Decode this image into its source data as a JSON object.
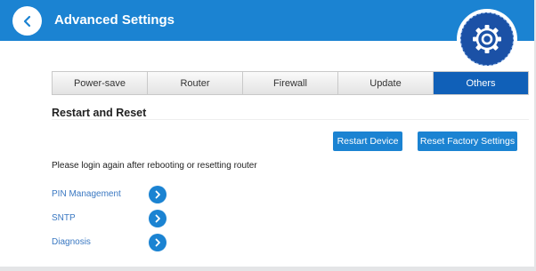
{
  "header": {
    "title": "Advanced Settings",
    "back_icon": "chevron-left-icon",
    "settings_icon": "gear-icon",
    "color": "#1b83d2"
  },
  "tabs": [
    {
      "label": "Power-save",
      "active": false
    },
    {
      "label": "Router",
      "active": false
    },
    {
      "label": "Firewall",
      "active": false
    },
    {
      "label": "Update",
      "active": false
    },
    {
      "label": "Others",
      "active": true
    }
  ],
  "section": {
    "title": "Restart and Reset",
    "restart_button": "Restart Device",
    "reset_button": "Reset Factory Settings",
    "notice": "Please login again after rebooting or resetting router"
  },
  "links": [
    {
      "label": "PIN Management",
      "icon": "chevron-right-icon"
    },
    {
      "label": "SNTP",
      "icon": "chevron-right-icon"
    },
    {
      "label": "Diagnosis",
      "icon": "chevron-right-icon"
    }
  ],
  "colors": {
    "accent": "#1b83d2",
    "active_tab": "#1060b8",
    "gear_circle": "#1b51a6",
    "link_text": "#3a78c2"
  }
}
